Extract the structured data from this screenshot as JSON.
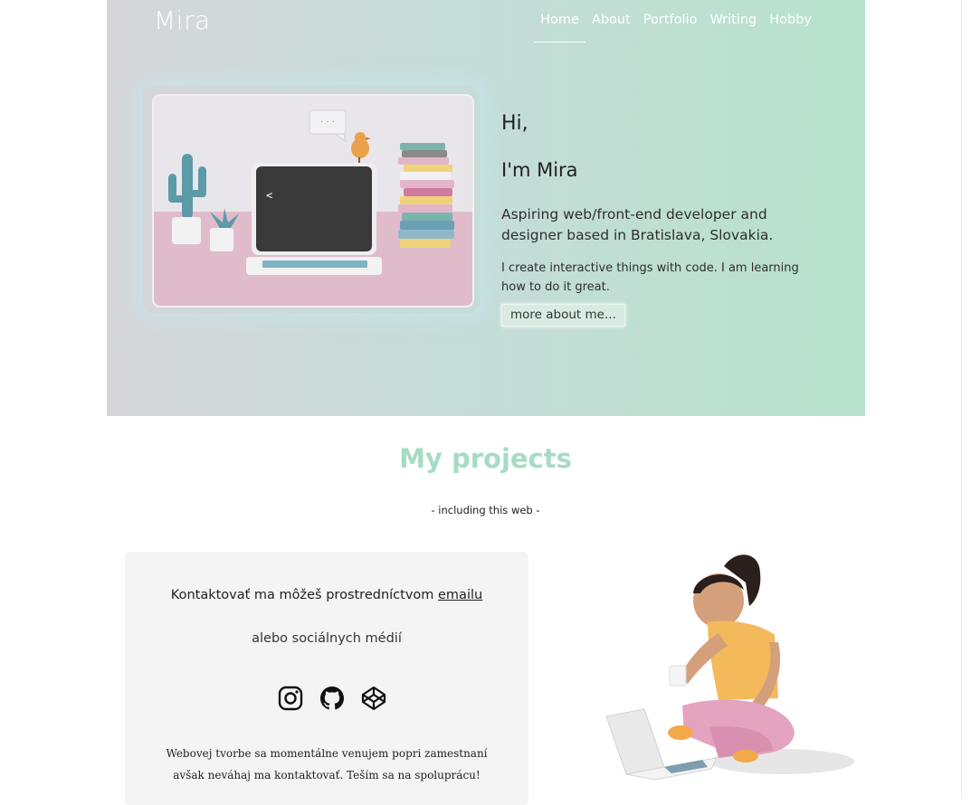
{
  "brand": "Mira",
  "nav": {
    "items": [
      {
        "label": "Home",
        "active": true
      },
      {
        "label": "About",
        "active": false
      },
      {
        "label": "Portfolio",
        "active": false
      },
      {
        "label": "Writing",
        "active": false
      },
      {
        "label": "Hobby",
        "active": false
      }
    ]
  },
  "hero": {
    "greeting": "Hi,",
    "intro": "I'm Mira",
    "tagline": "Aspiring web/front-end developer and designer based in Bratislava, Slovakia.",
    "description": "I create interactive things with code. I am learning how to do it great.",
    "more_button": "more about me...",
    "laptop_prompt": "<",
    "speech_dots": "· · ·"
  },
  "projects": {
    "title": "My projects",
    "subtitle": "- including this web -"
  },
  "contact": {
    "line_prefix": "Kontaktovať ma môžeš prostredníctvom ",
    "email_label": "emailu",
    "social_line": "alebo sociálnych médií",
    "icons": [
      "instagram-icon",
      "github-icon",
      "codepen-icon"
    ],
    "note": "Webovej tvorbe sa momentálne venujem popri zamestnaní avšak neváhaj ma kontaktovať. Teším sa na spoluprácu!"
  },
  "colors": {
    "hero_gradient_start": "#d6d6da",
    "hero_gradient_end": "#b7e2cd",
    "projects_title": "#a6dcc3",
    "card_bg": "#f4f4f5"
  }
}
